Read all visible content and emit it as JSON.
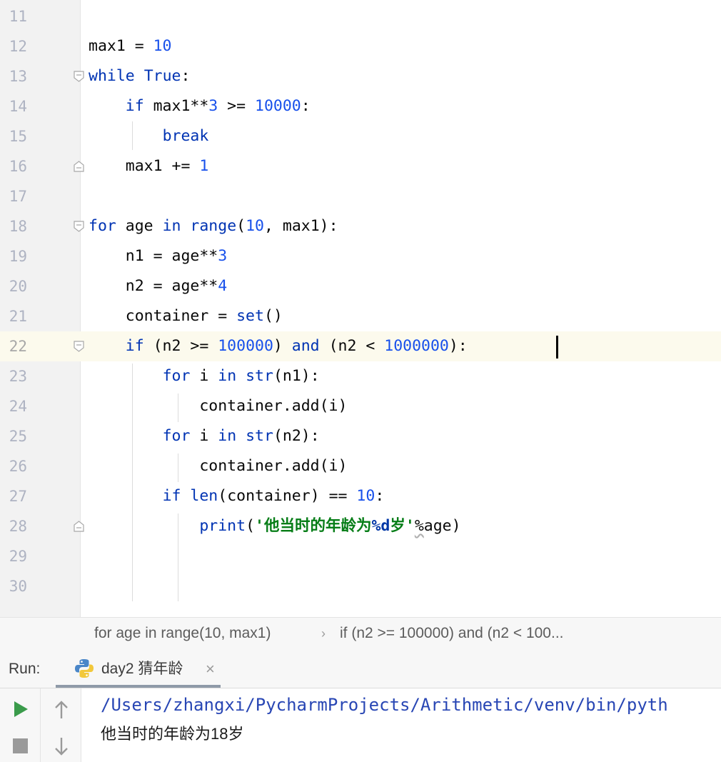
{
  "editor": {
    "current_line": "22",
    "lines": [
      {
        "num": "11",
        "parts": []
      },
      {
        "num": "12",
        "parts": [
          {
            "t": "max1 = ",
            "c": ""
          },
          {
            "t": "10",
            "c": "num"
          }
        ]
      },
      {
        "num": "13",
        "parts": [
          {
            "t": "while",
            "c": "kw"
          },
          {
            "t": " ",
            "c": ""
          },
          {
            "t": "True",
            "c": "kw"
          },
          {
            "t": ":",
            "c": ""
          }
        ]
      },
      {
        "num": "14",
        "parts": [
          {
            "t": "    ",
            "c": ""
          },
          {
            "t": "if",
            "c": "kw"
          },
          {
            "t": " max1**",
            "c": ""
          },
          {
            "t": "3",
            "c": "num"
          },
          {
            "t": " >= ",
            "c": ""
          },
          {
            "t": "10000",
            "c": "num"
          },
          {
            "t": ":",
            "c": ""
          }
        ]
      },
      {
        "num": "15",
        "parts": [
          {
            "t": "        ",
            "c": ""
          },
          {
            "t": "break",
            "c": "kw"
          }
        ]
      },
      {
        "num": "16",
        "parts": [
          {
            "t": "    max1 += ",
            "c": ""
          },
          {
            "t": "1",
            "c": "num"
          }
        ]
      },
      {
        "num": "17",
        "parts": []
      },
      {
        "num": "18",
        "parts": [
          {
            "t": "for",
            "c": "kw"
          },
          {
            "t": " age ",
            "c": ""
          },
          {
            "t": "in",
            "c": "kw"
          },
          {
            "t": " ",
            "c": ""
          },
          {
            "t": "range",
            "c": "kw"
          },
          {
            "t": "(",
            "c": ""
          },
          {
            "t": "10",
            "c": "num"
          },
          {
            "t": ", max1):",
            "c": ""
          }
        ]
      },
      {
        "num": "19",
        "parts": [
          {
            "t": "    n1 = age**",
            "c": ""
          },
          {
            "t": "3",
            "c": "num"
          }
        ]
      },
      {
        "num": "20",
        "parts": [
          {
            "t": "    n2 = age**",
            "c": ""
          },
          {
            "t": "4",
            "c": "num"
          }
        ]
      },
      {
        "num": "21",
        "parts": [
          {
            "t": "    container = ",
            "c": ""
          },
          {
            "t": "set",
            "c": "kw"
          },
          {
            "t": "()",
            "c": ""
          }
        ]
      },
      {
        "num": "22",
        "parts": [
          {
            "t": "    ",
            "c": ""
          },
          {
            "t": "if",
            "c": "kw"
          },
          {
            "t": " (n2 >= ",
            "c": ""
          },
          {
            "t": "100000",
            "c": "num"
          },
          {
            "t": ") ",
            "c": ""
          },
          {
            "t": "and",
            "c": "kw"
          },
          {
            "t": " (n2 < ",
            "c": ""
          },
          {
            "t": "1000000",
            "c": "num"
          },
          {
            "t": "):",
            "c": ""
          }
        ]
      },
      {
        "num": "23",
        "parts": [
          {
            "t": "        ",
            "c": ""
          },
          {
            "t": "for",
            "c": "kw"
          },
          {
            "t": " i ",
            "c": ""
          },
          {
            "t": "in",
            "c": "kw"
          },
          {
            "t": " ",
            "c": ""
          },
          {
            "t": "str",
            "c": "kw"
          },
          {
            "t": "(n1):",
            "c": ""
          }
        ]
      },
      {
        "num": "24",
        "parts": [
          {
            "t": "            container.add(i)",
            "c": ""
          }
        ]
      },
      {
        "num": "25",
        "parts": [
          {
            "t": "        ",
            "c": ""
          },
          {
            "t": "for",
            "c": "kw"
          },
          {
            "t": " i ",
            "c": ""
          },
          {
            "t": "in",
            "c": "kw"
          },
          {
            "t": " ",
            "c": ""
          },
          {
            "t": "str",
            "c": "kw"
          },
          {
            "t": "(n2):",
            "c": ""
          }
        ]
      },
      {
        "num": "26",
        "parts": [
          {
            "t": "            container.add(i)",
            "c": ""
          }
        ]
      },
      {
        "num": "27",
        "parts": [
          {
            "t": "        ",
            "c": ""
          },
          {
            "t": "if",
            "c": "kw"
          },
          {
            "t": " ",
            "c": ""
          },
          {
            "t": "len",
            "c": "kw"
          },
          {
            "t": "(container) == ",
            "c": ""
          },
          {
            "t": "10",
            "c": "num"
          },
          {
            "t": ":",
            "c": ""
          }
        ]
      },
      {
        "num": "28",
        "parts": [
          {
            "t": "            ",
            "c": ""
          },
          {
            "t": "print",
            "c": "kw"
          },
          {
            "t": "(",
            "c": ""
          },
          {
            "t": "'他当时的年龄为",
            "c": "str"
          },
          {
            "t": "%d",
            "c": "fmt"
          },
          {
            "t": "岁'",
            "c": "str"
          },
          {
            "t": "%",
            "c": "squiggle"
          },
          {
            "t": "age)",
            "c": ""
          }
        ]
      },
      {
        "num": "29",
        "parts": []
      },
      {
        "num": "30",
        "parts": []
      }
    ]
  },
  "breadcrumb": {
    "items": [
      "for age in range(10, max1)",
      "if (n2 >= 100000) and (n2 < 100..."
    ],
    "separator": "›"
  },
  "run": {
    "label": "Run:",
    "tab_title": "day2 猜年龄",
    "close_glyph": "×",
    "icons": {
      "run": "run-icon",
      "stop": "stop-icon",
      "up": "scroll-up-icon",
      "down": "scroll-down-icon",
      "python": "python-icon"
    }
  },
  "console": {
    "path_line": "/Users/zhangxi/PycharmProjects/Arithmetic/venv/bin/pyth",
    "output_line": "他当时的年龄为18岁"
  },
  "colors": {
    "keyword": "#0033b3",
    "number": "#1750eb",
    "string": "#067d17",
    "current_line_bg": "#fcfaed",
    "console_path": "#2846b4",
    "run_green": "#3a9b4b"
  }
}
